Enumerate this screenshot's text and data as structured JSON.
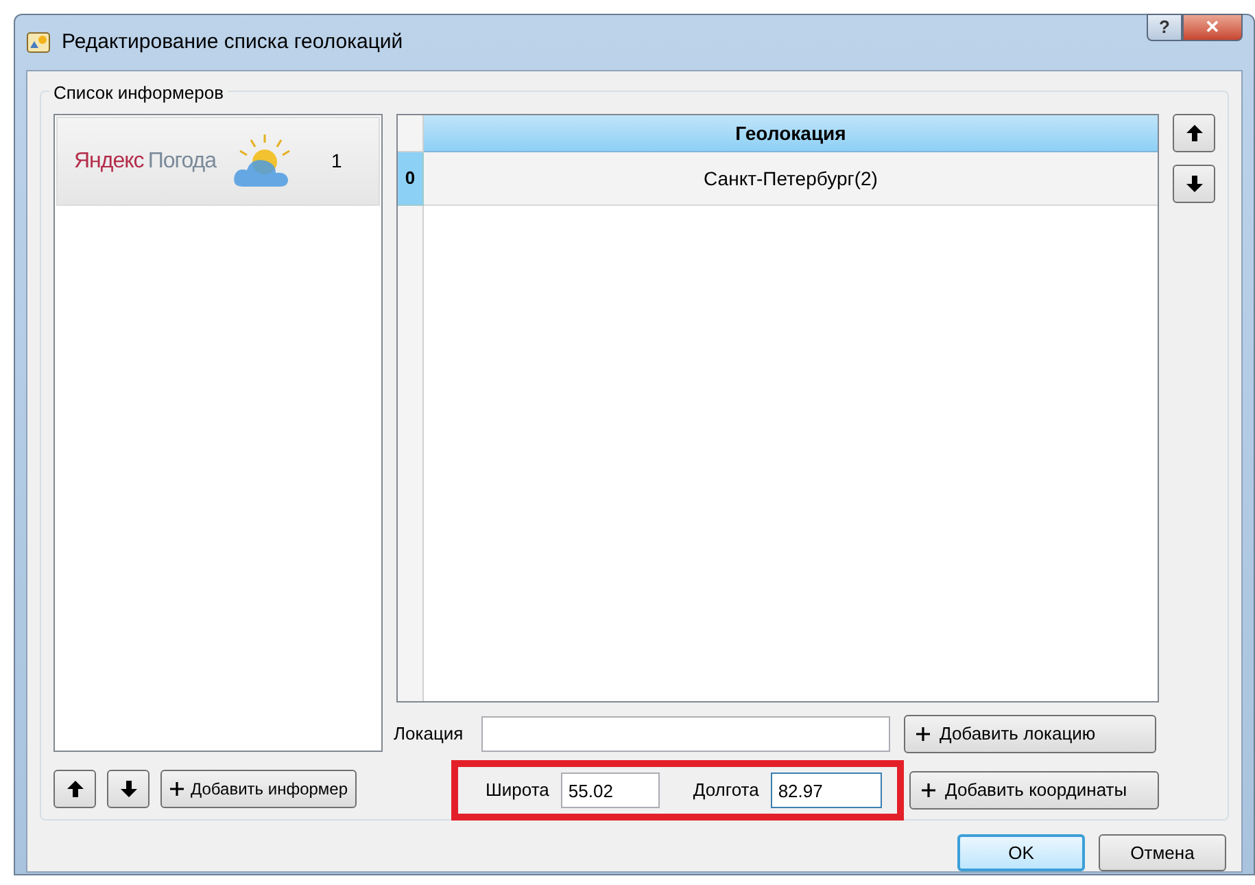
{
  "window": {
    "title": "Редактирование списка геолокаций",
    "buttons": [
      {
        "kind": "help",
        "label": "?"
      },
      {
        "kind": "close",
        "label": "✕"
      }
    ]
  },
  "informers": {
    "group_label": "Список информеров",
    "items": [
      {
        "logo_words": [
          "Яндекс",
          "Погода"
        ],
        "count": "1"
      }
    ],
    "buttons": [
      {
        "kind": "up"
      },
      {
        "kind": "down"
      },
      {
        "kind": "add",
        "label": "Добавить информер"
      }
    ]
  },
  "table": {
    "columns": [
      "Геолокация"
    ],
    "rows": [
      {
        "index": "0",
        "selected": true,
        "cells": [
          "Санкт-Петербург(2)"
        ]
      }
    ]
  },
  "side_buttons": [
    {
      "kind": "up"
    },
    {
      "kind": "down"
    }
  ],
  "location": {
    "label": "Локация",
    "button": "Добавить локацию"
  },
  "coordinates": {
    "highlighted": true,
    "latitude_label": "Широта",
    "latitude": "55.02",
    "longitude_label": "Долгота",
    "longitude": "82.97",
    "button": "Добавить координаты"
  },
  "footer_buttons": [
    {
      "label": "OK",
      "default": true
    },
    {
      "label": "Отмена",
      "default": false
    }
  ]
}
